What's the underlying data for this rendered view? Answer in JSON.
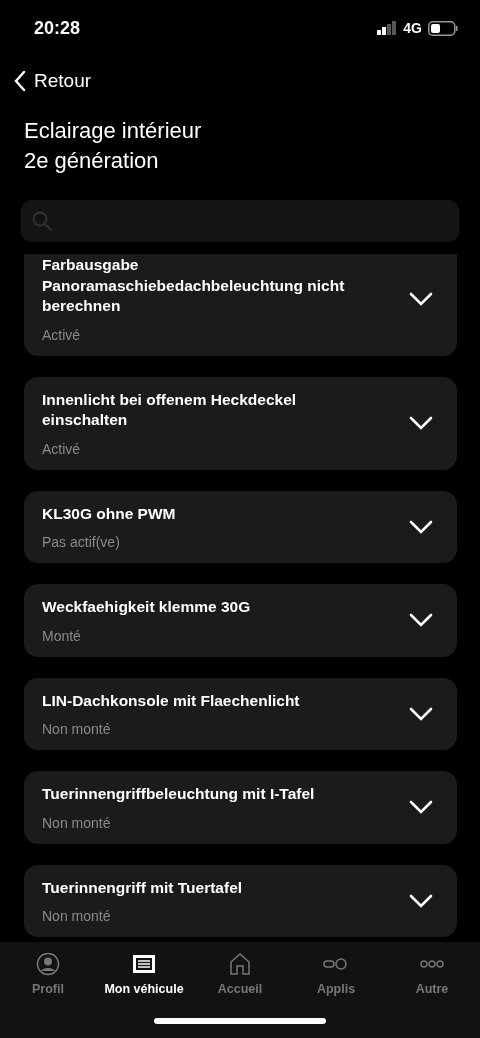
{
  "status_bar": {
    "time": "20:28",
    "network": "4G"
  },
  "nav": {
    "back": "Retour"
  },
  "title_lines": [
    "Eclairage intérieur",
    "2e génération"
  ],
  "settings": [
    {
      "name": "Farbausgabe Panoramaschiebedachbeleuchtung nicht berechnen",
      "value": "Activé",
      "expanded": false
    },
    {
      "name": "Innenlicht bei offenem Heckdeckel einschalten",
      "value": "Activé",
      "expanded": false
    },
    {
      "name": "KL30G ohne PWM",
      "value": "Pas actif(ve)",
      "expanded": false
    },
    {
      "name": "Weckfaehigkeit klemme 30G",
      "value": "Monté",
      "expanded": false
    },
    {
      "name": "LIN-Dachkonsole mit Flaechenlicht",
      "value": "Non monté",
      "expanded": false
    },
    {
      "name": "Tuerinnengriffbeleuchtung mit I-Tafel",
      "value": "Non monté",
      "expanded": false
    },
    {
      "name": "Tuerinnengriff mit Tuertafel",
      "value": "Non monté",
      "expanded": false
    }
  ],
  "tab_bar": [
    {
      "kind": "profile",
      "label": "Profil",
      "selected": false
    },
    {
      "kind": "vehicle",
      "label": "Mon véhicule",
      "selected": true
    },
    {
      "kind": "home",
      "label": "Accueil",
      "selected": false
    },
    {
      "kind": "apps",
      "label": "Applis",
      "selected": false
    },
    {
      "kind": "more",
      "label": "Autre",
      "selected": false
    }
  ]
}
